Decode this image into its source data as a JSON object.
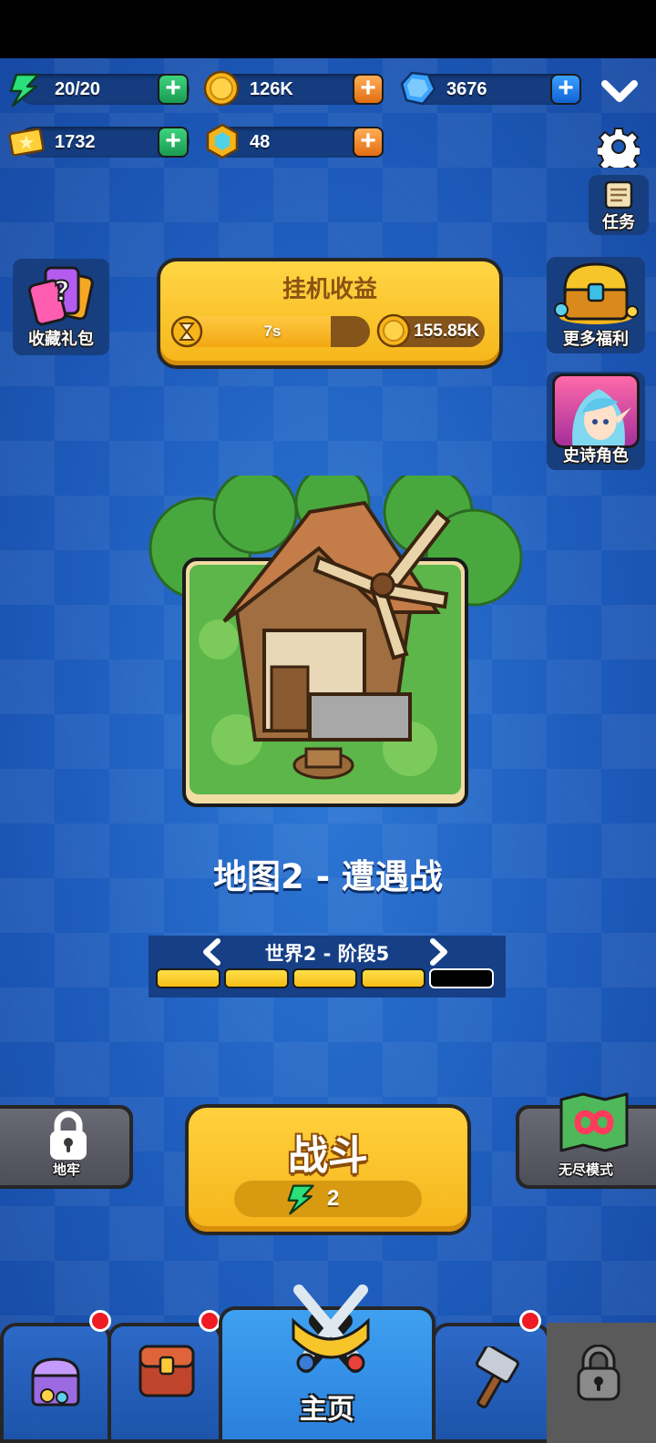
{
  "resources": {
    "energy": "20/20",
    "gold": "126K",
    "gems": "3676",
    "tickets": "1732",
    "crystals": "48"
  },
  "quests": {
    "label": "任务"
  },
  "side_left": {
    "collect_pack": "收藏礼包"
  },
  "side_right": {
    "more_rewards": "更多福利",
    "epic_hero": "史诗角色"
  },
  "idle": {
    "title": "挂机收益",
    "timer": "7s",
    "progress": 0.8,
    "earnings": "155.85K"
  },
  "map": {
    "title": "地图2 - 遭遇战"
  },
  "stage": {
    "label": "世界2 - 阶段5",
    "segments_total": 5,
    "segments_done": 4
  },
  "fight": {
    "label": "战斗",
    "cost": "2"
  },
  "dungeon": {
    "label": "地牢"
  },
  "endless": {
    "label": "无尽模式"
  },
  "tabs": {
    "home": "主页"
  },
  "colors": {
    "accent": "#f6b61a",
    "background": "#1d5ab8",
    "badge": "#ee1b24"
  }
}
